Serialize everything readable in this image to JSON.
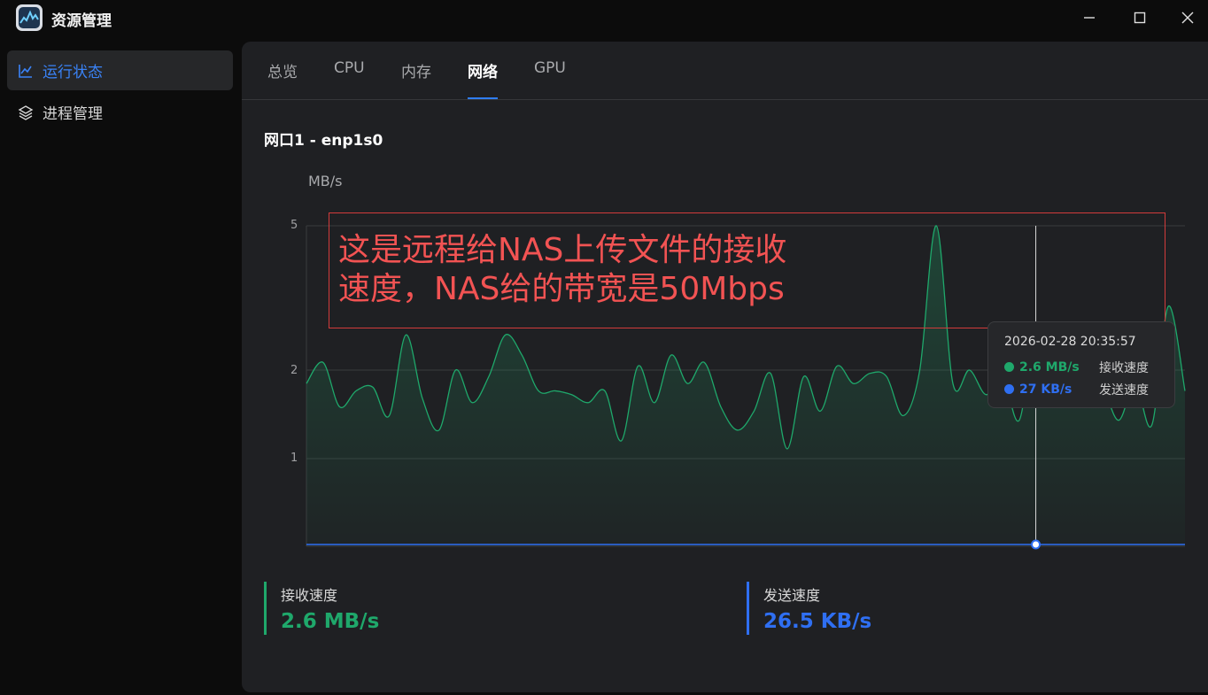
{
  "window": {
    "title": "资源管理"
  },
  "sidebar": {
    "items": [
      {
        "label": "运行状态",
        "icon": "line-chart-icon",
        "active": true
      },
      {
        "label": "进程管理",
        "icon": "layers-icon",
        "active": false
      }
    ]
  },
  "tabs": [
    {
      "label": "总览",
      "active": false
    },
    {
      "label": "CPU",
      "active": false
    },
    {
      "label": "内存",
      "active": false
    },
    {
      "label": "网络",
      "active": true
    },
    {
      "label": "GPU",
      "active": false
    }
  ],
  "network": {
    "interface_title": "网口1 - enp1s0",
    "unit": "MB/s"
  },
  "tooltip": {
    "timestamp": "2026-02-28 20:35:57",
    "rx_value": "2.6 MB/s",
    "rx_label": "接收速度",
    "tx_value": "27 KB/s",
    "tx_label": "发送速度"
  },
  "annotation": {
    "line1": "这是远程给NAS上传文件的接收",
    "line2": "速度，NAS给的带宽是50Mbps"
  },
  "stats": {
    "rx": {
      "label": "接收速度",
      "value": "2.6 MB/s"
    },
    "tx": {
      "label": "发送速度",
      "value": "26.5 KB/s"
    }
  },
  "colors": {
    "accent": "#2f7df6",
    "rx": "#1fa86b",
    "tx": "#2f6ff2",
    "annotation": "#f25353"
  },
  "chart_data": {
    "type": "area",
    "ylabel": "MB/s",
    "yscale": "log",
    "yticks": [
      1,
      2,
      5
    ],
    "ylim": [
      0.4,
      5
    ],
    "grid": true,
    "cursor_index": 44,
    "series": [
      {
        "name": "接收速度",
        "values": [
          1.8,
          2.1,
          1.5,
          1.7,
          1.75,
          1.4,
          2.5,
          1.6,
          1.25,
          2.0,
          1.55,
          1.9,
          2.5,
          2.2,
          1.7,
          1.7,
          1.65,
          1.55,
          1.7,
          1.15,
          2.05,
          1.55,
          2.2,
          1.8,
          2.1,
          1.5,
          1.25,
          1.45,
          1.95,
          1.08,
          1.9,
          1.45,
          2.05,
          1.8,
          1.95,
          1.9,
          1.4,
          2.0,
          5.0,
          1.8,
          2.0,
          1.65,
          1.9,
          1.35,
          2.6,
          1.6,
          1.9,
          1.7,
          1.75,
          1.35,
          1.8,
          1.3,
          3.0,
          1.7
        ]
      },
      {
        "name": "发送速度",
        "values": [
          0.027,
          0.027,
          0.027,
          0.027,
          0.027,
          0.027,
          0.027,
          0.027,
          0.027,
          0.027,
          0.027,
          0.027,
          0.027,
          0.027,
          0.027,
          0.027,
          0.027,
          0.027,
          0.027,
          0.027,
          0.027,
          0.027,
          0.027,
          0.027,
          0.027,
          0.027,
          0.027,
          0.027,
          0.027,
          0.027,
          0.027,
          0.027,
          0.027,
          0.027,
          0.027,
          0.027,
          0.027,
          0.027,
          0.03,
          0.027,
          0.027,
          0.027,
          0.027,
          0.027,
          0.027,
          0.027,
          0.027,
          0.027,
          0.027,
          0.027,
          0.027,
          0.027,
          0.027,
          0.027
        ]
      }
    ]
  }
}
